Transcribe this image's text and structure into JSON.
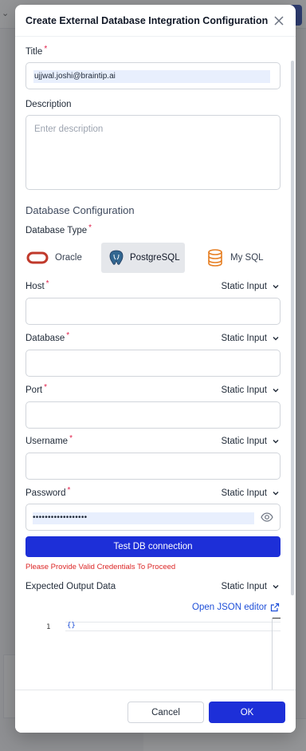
{
  "modal": {
    "title": "Create External Database Integration Configuration"
  },
  "form": {
    "title_label": "Title",
    "title_value": "ujjwal.joshi@braintip.ai",
    "description_label": "Description",
    "description_placeholder": "Enter description",
    "section_title": "Database Configuration",
    "db_type_label": "Database Type",
    "db_types": [
      {
        "label": "Oracle",
        "icon": "oracle-icon"
      },
      {
        "label": "PostgreSQL",
        "icon": "postgresql-icon",
        "selected": true
      },
      {
        "label": "My SQL",
        "icon": "database-icon"
      }
    ],
    "input_mode": "Static Input",
    "host_label": "Host",
    "database_label": "Database",
    "port_label": "Port",
    "username_label": "Username",
    "password_label": "Password",
    "password_value": "••••••••••••••••••",
    "test_button": "Test DB connection",
    "error_message": "Please Provide Valid Credentials To Proceed",
    "output_label": "Expected Output Data",
    "json_editor_link": "Open JSON editor",
    "editor_line_number": "1",
    "editor_content": "{}"
  },
  "footer": {
    "cancel": "Cancel",
    "ok": "OK"
  },
  "colors": {
    "primary": "#1d2fd8",
    "error": "#dc2626",
    "required": "#e11d48",
    "oracle": "#c0392b",
    "mysql": "#e67e22"
  }
}
